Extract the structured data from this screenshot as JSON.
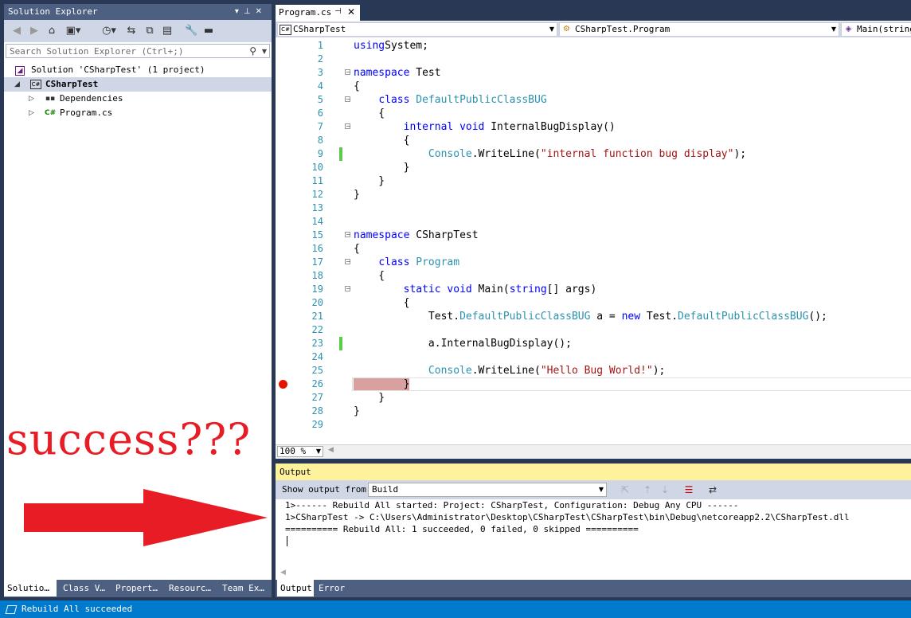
{
  "solution_explorer": {
    "title": "Solution Explorer",
    "title_buttons": [
      "▾",
      "⊥",
      "✕"
    ],
    "search_placeholder": "Search Solution Explorer (Ctrl+;)",
    "tree": [
      {
        "label": "Solution 'CSharpTest' (1 project)",
        "icon": "solution-icon"
      },
      {
        "label": "CSharpTest",
        "icon": "csharp-project-icon"
      },
      {
        "label": "Dependencies",
        "icon": "dependencies-icon"
      },
      {
        "label": "Program.cs",
        "icon": "csharp-file-icon"
      }
    ],
    "tabs": [
      "Solutio…",
      "Class V…",
      "Propert…",
      "Resourc…",
      "Team Ex…"
    ]
  },
  "annotation": {
    "text": "success???",
    "color": "#e81c24"
  },
  "editor": {
    "tab_label": "Program.cs",
    "nav": {
      "project": "CSharpTest",
      "class": "CSharpTest.Program",
      "member": "Main(string"
    },
    "zoom": "100 %",
    "lines": [
      {
        "n": "1",
        "code": [
          [
            "kw",
            "using"
          ],
          [
            "",
            "System;"
          ]
        ]
      },
      {
        "n": "2",
        "code": []
      },
      {
        "n": "3",
        "code": [
          [
            "kw",
            "namespace"
          ],
          [
            "",
            " Test"
          ]
        ]
      },
      {
        "n": "4",
        "code": [
          [
            "",
            "{"
          ]
        ]
      },
      {
        "n": "5",
        "code": [
          [
            "",
            "    "
          ],
          [
            "kw",
            "class"
          ],
          [
            "",
            " "
          ],
          [
            "ty",
            "DefaultPublicClassBUG"
          ]
        ]
      },
      {
        "n": "6",
        "code": [
          [
            "",
            "    {"
          ]
        ]
      },
      {
        "n": "7",
        "code": [
          [
            "",
            "        "
          ],
          [
            "kw",
            "internal"
          ],
          [
            "",
            " "
          ],
          [
            "kw",
            "void"
          ],
          [
            "",
            " InternalBugDisplay()"
          ]
        ]
      },
      {
        "n": "8",
        "code": [
          [
            "",
            "        {"
          ]
        ]
      },
      {
        "n": "9",
        "code": [
          [
            "",
            "            "
          ],
          [
            "ty",
            "Console"
          ],
          [
            "",
            ".WriteLine("
          ],
          [
            "str",
            "\"internal function bug display\""
          ],
          [
            "",
            ");"
          ]
        ]
      },
      {
        "n": "10",
        "code": [
          [
            "",
            "        }"
          ]
        ]
      },
      {
        "n": "11",
        "code": [
          [
            "",
            "    }"
          ]
        ]
      },
      {
        "n": "12",
        "code": [
          [
            "",
            "}"
          ]
        ]
      },
      {
        "n": "13",
        "code": []
      },
      {
        "n": "14",
        "code": []
      },
      {
        "n": "15",
        "code": [
          [
            "kw",
            "namespace"
          ],
          [
            "",
            " CSharpTest"
          ]
        ]
      },
      {
        "n": "16",
        "code": [
          [
            "",
            "{"
          ]
        ]
      },
      {
        "n": "17",
        "code": [
          [
            "",
            "    "
          ],
          [
            "kw",
            "class"
          ],
          [
            "",
            " "
          ],
          [
            "ty",
            "Program"
          ]
        ]
      },
      {
        "n": "18",
        "code": [
          [
            "",
            "    {"
          ]
        ]
      },
      {
        "n": "19",
        "code": [
          [
            "",
            "        "
          ],
          [
            "kw",
            "static"
          ],
          [
            "",
            " "
          ],
          [
            "kw",
            "void"
          ],
          [
            "",
            " Main("
          ],
          [
            "kw",
            "string"
          ],
          [
            "",
            "[] args)"
          ]
        ]
      },
      {
        "n": "20",
        "code": [
          [
            "",
            "        {"
          ]
        ]
      },
      {
        "n": "21",
        "code": [
          [
            "",
            "            Test."
          ],
          [
            "ty",
            "DefaultPublicClassBUG"
          ],
          [
            "",
            " a = "
          ],
          [
            "kw",
            "new"
          ],
          [
            "",
            " Test."
          ],
          [
            "ty",
            "DefaultPublicClassBUG"
          ],
          [
            "",
            "();"
          ]
        ]
      },
      {
        "n": "22",
        "code": []
      },
      {
        "n": "23",
        "code": [
          [
            "",
            "            a.InternalBugDisplay();"
          ]
        ]
      },
      {
        "n": "24",
        "code": []
      },
      {
        "n": "25",
        "code": [
          [
            "",
            "            "
          ],
          [
            "ty",
            "Console"
          ],
          [
            "",
            ".WriteLine("
          ],
          [
            "str",
            "\"Hello Bug World!\""
          ],
          [
            "",
            ");"
          ]
        ]
      },
      {
        "n": "26",
        "code": [
          [
            "",
            "        }"
          ]
        ]
      },
      {
        "n": "27",
        "code": [
          [
            "",
            "    }"
          ]
        ]
      },
      {
        "n": "28",
        "code": [
          [
            "",
            "}"
          ]
        ]
      },
      {
        "n": "29",
        "code": []
      }
    ]
  },
  "output": {
    "title": "Output",
    "show_from_label": "Show output from:",
    "source": "Build",
    "lines": [
      "1>------ Rebuild All started: Project: CSharpTest, Configuration: Debug Any CPU ------",
      "1>CSharpTest -> C:\\Users\\Administrator\\Desktop\\CSharpTest\\CSharpTest\\bin\\Debug\\netcoreapp2.2\\CSharpTest.dll",
      "========== Rebuild All: 1 succeeded, 0 failed, 0 skipped =========="
    ],
    "tabs": [
      "Output",
      "Error List"
    ]
  },
  "status": {
    "text": "Rebuild All succeeded",
    "color": "#007acc"
  }
}
